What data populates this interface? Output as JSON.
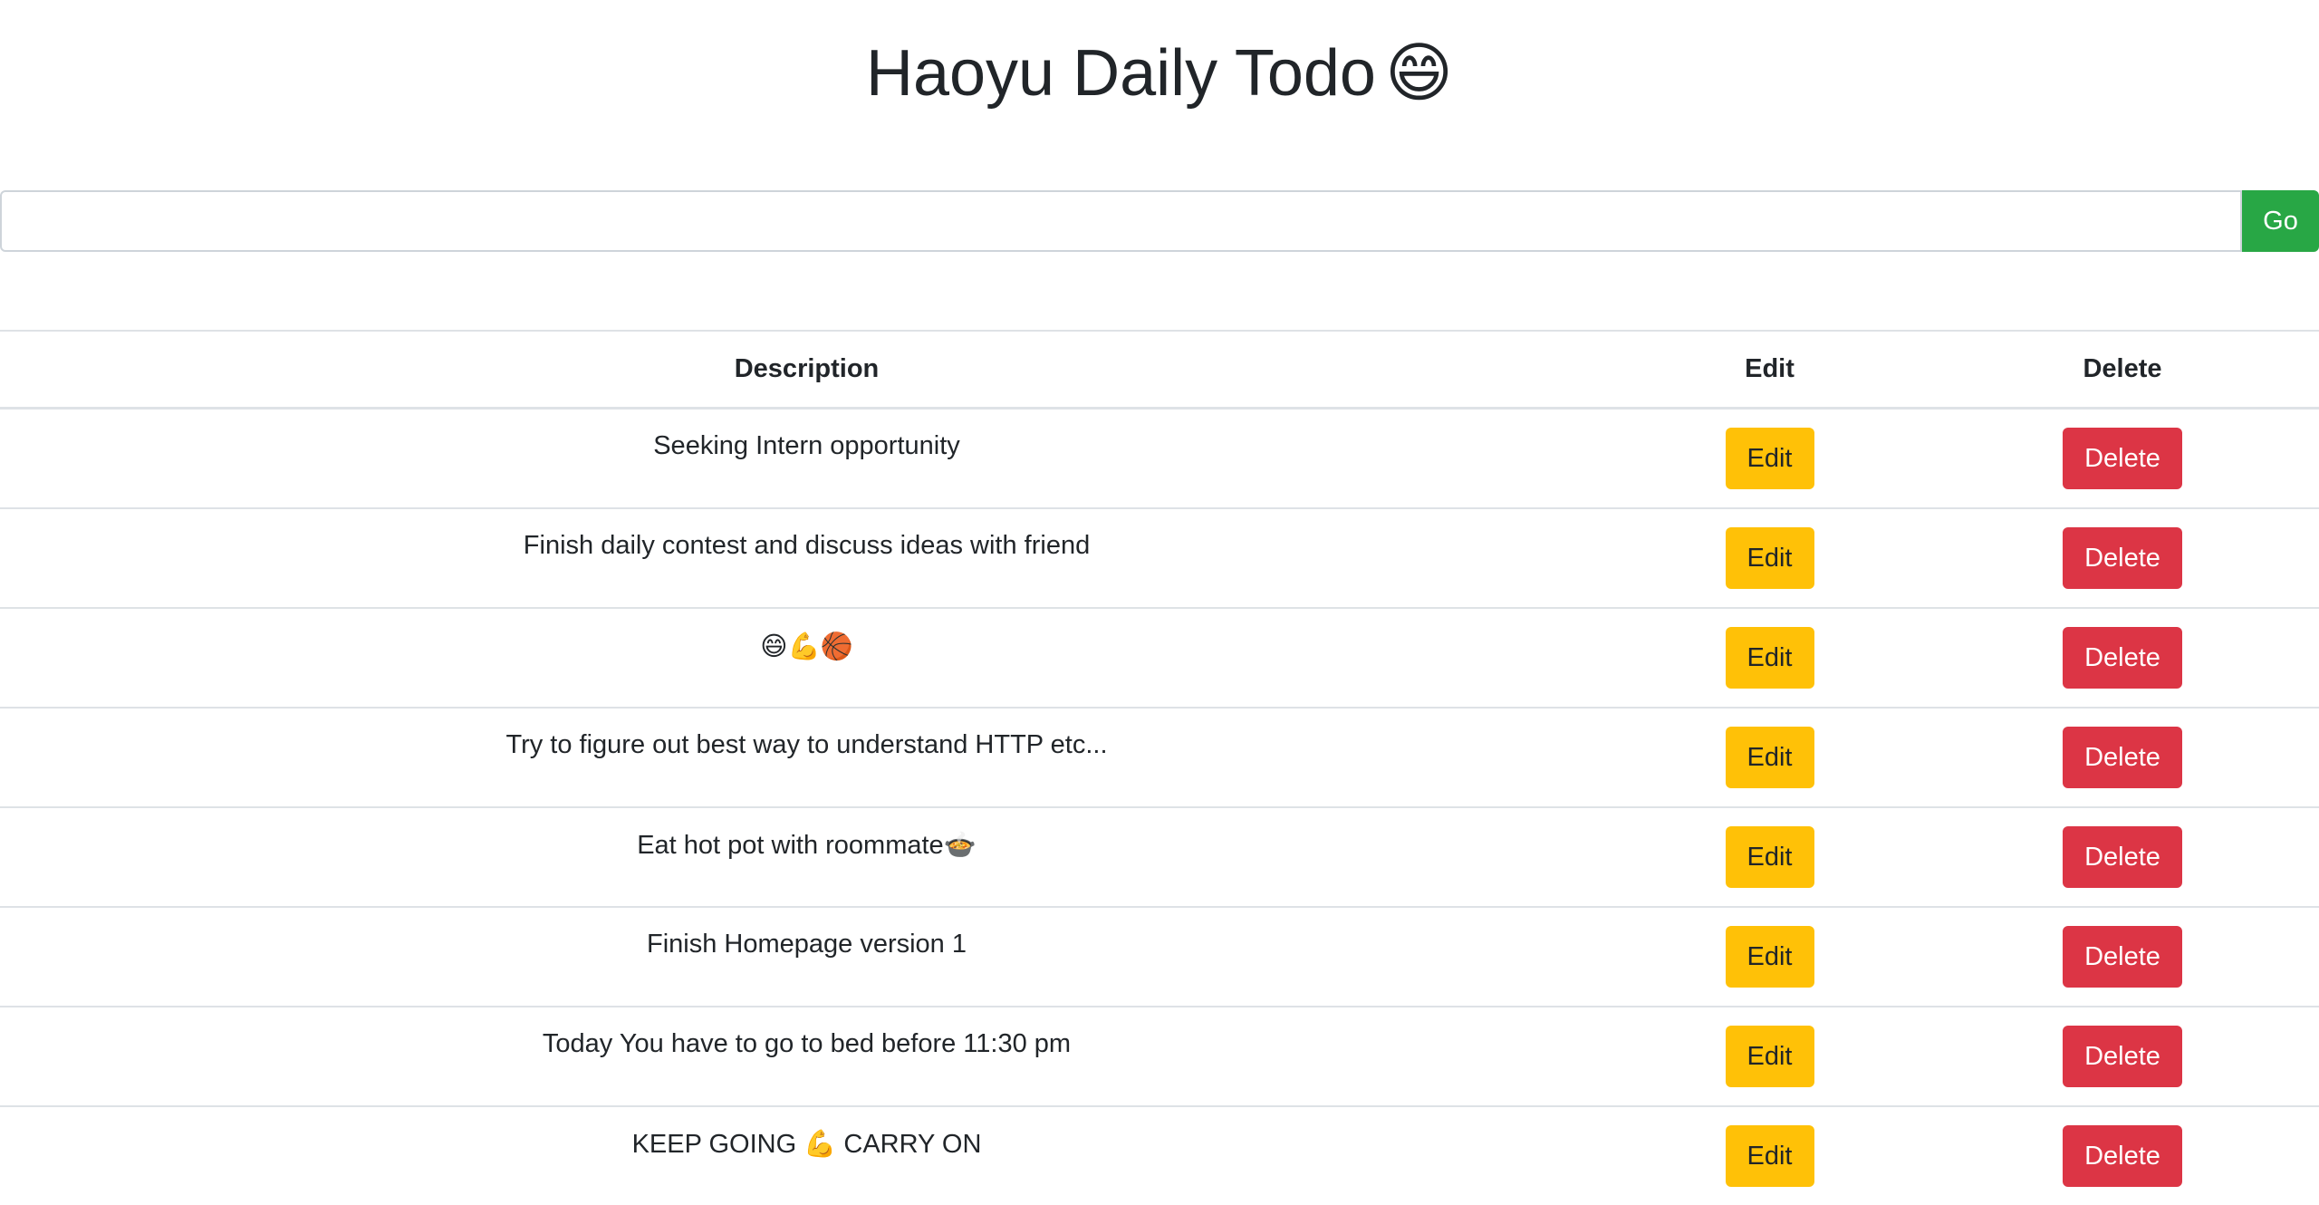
{
  "page": {
    "title": "Haoyu Daily Todo",
    "title_emoji": "😄"
  },
  "input": {
    "value": "",
    "placeholder": "",
    "submit_label": "Go"
  },
  "table": {
    "headers": {
      "description": "Description",
      "edit": "Edit",
      "delete": "Delete"
    },
    "rows": [
      {
        "description": "Seeking Intern opportunity",
        "edit_label": "Edit",
        "delete_label": "Delete"
      },
      {
        "description": "Finish daily contest and discuss ideas with friend",
        "edit_label": "Edit",
        "delete_label": "Delete"
      },
      {
        "description": "😄💪🏀",
        "edit_label": "Edit",
        "delete_label": "Delete"
      },
      {
        "description": "Try to figure out best way to understand HTTP etc...",
        "edit_label": "Edit",
        "delete_label": "Delete"
      },
      {
        "description": "Eat hot pot with roommate🍲",
        "edit_label": "Edit",
        "delete_label": "Delete"
      },
      {
        "description": "Finish Homepage version 1",
        "edit_label": "Edit",
        "delete_label": "Delete"
      },
      {
        "description": "Today You have to go to bed before 11:30 pm",
        "edit_label": "Edit",
        "delete_label": "Delete"
      },
      {
        "description": "KEEP GOING 💪 CARRY ON",
        "edit_label": "Edit",
        "delete_label": "Delete"
      }
    ]
  },
  "colors": {
    "go_button": "#28a745",
    "edit_button": "#ffc107",
    "delete_button": "#dc3545",
    "text": "#212529",
    "border": "#dee2e6"
  }
}
